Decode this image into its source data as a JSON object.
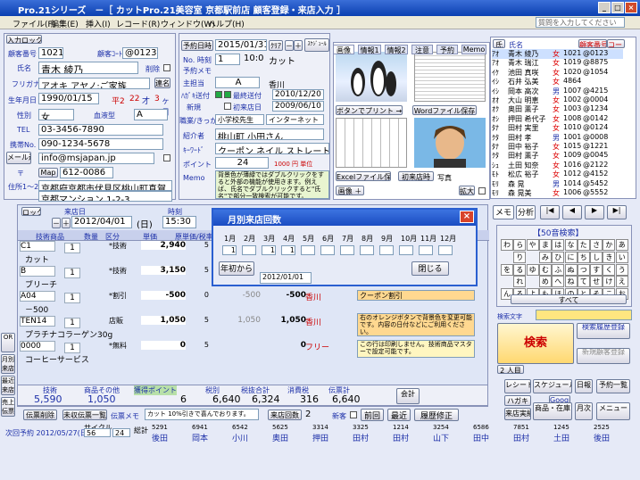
{
  "app": {
    "title": "Pro.21シリーズ　－［ カットPro.21美容室  京都駅前店  顧客登録・来店入力 ］",
    "help_placeholder": "質問を入力してください"
  },
  "menu": [
    "ファイル(F)",
    "編集(E)",
    "挿入(I)",
    "レコード(R)",
    "ウィンドウ(W)",
    "ヘルプ(H)"
  ],
  "customer": {
    "new_label": "入力ロック",
    "number_label": "顧客番号",
    "number": "1021",
    "code_label": "顧客ｺｰﾄﾞ",
    "code": "@0123",
    "delete_label": "削除",
    "name_label": "氏名",
    "name": "青木  綾乃",
    "furigana_label": "フリガナ",
    "furigana": "アオキ アヤノ:ご家族",
    "renraku": "連名",
    "birth_label": "生年月日",
    "birth": "1990/01/15",
    "era": "平2",
    "age": "22",
    "age_unit": "才",
    "month": "3",
    "month_unit": "ヶ月",
    "sex_label": "性別",
    "sex": "女",
    "blood_label": "血液型",
    "blood": "A",
    "tel_label": "TEL",
    "tel": "03-3456-7890",
    "mobile_label": "携帯No.",
    "mobile": "090-1234-5678",
    "mail_btn": "メール送信",
    "mail": "info@msjapan.jp",
    "postal_label": "〒",
    "map_btn": "Map",
    "postal": "612-0086",
    "addr_label": "住所1～2",
    "addr1": "京都府京都市伏見区桃山町真賀",
    "addr2": "京都マンション  1-2-3"
  },
  "reservation": {
    "yoyaku_btn": "予約日時",
    "date": "2015/01/31",
    "clear": "ｸﾘｱ",
    "minus": "－",
    "plus": "＋",
    "schedule": "ｽｹｼﾞｭｰﾙ",
    "no_label": "No.  時刻",
    "no": "1",
    "time": "10:00",
    "menu": "カット",
    "yoyaku_menu": "予約メモ",
    "staff_label": "主担当",
    "staff": "A",
    "staff_name": "香川",
    "dm_label": "ﾊｶﾞｷ送付",
    "dm_check": "最終送付",
    "dm_date": "2010/12/20",
    "new_label": "新規",
    "first_label": "初来店日",
    "first_date": "2009/06/10",
    "job_label": "職業/きっかけ",
    "job": "小学校先生",
    "trigger": "インターネット",
    "intro_label": "紹介者",
    "intro": "桃山町  小田さん",
    "keyword_label": "ｷｰﾜｰﾄﾞ",
    "keyword": "クーポン  ネイル  ストレート",
    "point_label": "ポイント",
    "point": "24",
    "point_unit": "1000 円 単位",
    "memo_label": "Memo",
    "memo": "背景色が薄緑ではダブルクリックをすると外部の機能が使用きます。例えば、氏名でダブルクリックすると\"氏名\"で部分一致検索が可能です。"
  },
  "image_tabs": [
    "画像",
    "情報1",
    "情報2",
    "注意",
    "予約",
    "Memo"
  ],
  "image_buttons": {
    "print": "ボタンでプリント →",
    "word": "Wordファイル保存",
    "excel": "Excelファイル保存",
    "visit": "初来店時",
    "photo": "写真",
    "image": "画像 ＋",
    "expand": "拡大"
  },
  "customer_list": {
    "header_name": "氏名",
    "header_code": "顧客番号",
    "header_code2": "コード",
    "rows": [
      {
        "kana": "ｱｵ",
        "name": "青木  綾乃",
        "sex": "女",
        "no": "1021",
        "code": "@0123"
      },
      {
        "kana": "ｱｵ",
        "name": "青木  瑞江",
        "sex": "女",
        "no": "1019",
        "code": "@8875"
      },
      {
        "kana": "ｲｹ",
        "name": "池田  真咲",
        "sex": "女",
        "no": "1020",
        "code": "@1054"
      },
      {
        "kana": "ｲｼ",
        "name": "石井  弘美",
        "sex": "女",
        "no": "4864",
        "code": ""
      },
      {
        "kana": "ｲｼ",
        "name": "岡本  高次",
        "sex": "男",
        "no": "1007",
        "code": "@4215"
      },
      {
        "kana": "ｵｵ",
        "name": "大山  明恵",
        "sex": "女",
        "no": "1002",
        "code": "@0004"
      },
      {
        "kana": "ｵｸ",
        "name": "奥田  薫子",
        "sex": "女",
        "no": "1003",
        "code": "@1234"
      },
      {
        "kana": "ｵｼ",
        "name": "押田  希代子",
        "sex": "女",
        "no": "1008",
        "code": "@0142"
      },
      {
        "kana": "ﾀﾅ",
        "name": "田村  実里",
        "sex": "女",
        "no": "1010",
        "code": "@0124"
      },
      {
        "kana": "ｸﾀ",
        "name": "田村  孝",
        "sex": "男",
        "no": "1001",
        "code": "@0008"
      },
      {
        "kana": "ﾀﾅ",
        "name": "田中  裕子",
        "sex": "女",
        "no": "1015",
        "code": "@1221"
      },
      {
        "kana": "ｸﾀ",
        "name": "田村  薫子",
        "sex": "女",
        "no": "1009",
        "code": "@0045"
      },
      {
        "kana": "ｼｭ",
        "name": "土田  知奈",
        "sex": "女",
        "no": "1016",
        "code": "@2122"
      },
      {
        "kana": "ﾓﾄ",
        "name": "松広  裕子",
        "sex": "女",
        "no": "1012",
        "code": "@4152"
      },
      {
        "kana": "ﾓﾘ",
        "name": "森  晃",
        "sex": "男",
        "no": "1014",
        "code": "@5452"
      },
      {
        "kana": "ﾓﾘ",
        "name": "森  晃美",
        "sex": "女",
        "no": "1006",
        "code": "@5552"
      }
    ]
  },
  "nav": {
    "memo": "メモ",
    "analysis": "分析",
    "kana_title": "【50音検索】",
    "kana": [
      "わ",
      "ら",
      "や",
      "ま",
      "は",
      "な",
      "た",
      "さ",
      "か",
      "あ",
      "",
      "り",
      "",
      "み",
      "ひ",
      "に",
      "ち",
      "し",
      "き",
      "い",
      "を",
      "る",
      "ゆ",
      "む",
      "ふ",
      "ぬ",
      "つ",
      "す",
      "く",
      "う",
      "",
      "れ",
      "",
      "め",
      "へ",
      "ね",
      "て",
      "せ",
      "け",
      "え",
      "ん",
      "ろ",
      "よ",
      "も",
      "ほ",
      "の",
      "と",
      "そ",
      "こ",
      "お"
    ],
    "all": "すべて",
    "search_label": "検索文字",
    "search_btn": "検索",
    "history": "検索履歴登録",
    "persons": "2 人目",
    "new_reg": "新規顧客登録",
    "receipt": "レシート",
    "schedule": "スケジュール",
    "hagaki": "ハガキ",
    "reserve_list": "予約一覧",
    "calendar": "日報",
    "visit_result": "来店実績",
    "product": "商品・在庫",
    "monthly": "月次",
    "menu": "メニュー",
    "google": "Google",
    "zenkai": "前回"
  },
  "visit": {
    "lock": "ロック",
    "visit_label": "来店日",
    "date": "2012/04/01",
    "dow": "(日)",
    "time_label": "時刻",
    "time": "15:30",
    "minus": "－",
    "plus": "＋"
  },
  "sales_header": [
    "技術商品",
    "数量",
    "区分",
    "単価",
    "原単価/税率",
    "原価",
    "税込合計",
    "担当",
    "残"
  ],
  "sales_rows": [
    {
      "code": "C1",
      "name": "カット",
      "qty": "1",
      "kind": "*技術",
      "price": "2,940",
      "tax": "5",
      "staff": ""
    },
    {
      "code": "B",
      "name": "ブリーチ",
      "qty": "1",
      "kind": "*技術",
      "price": "3,150",
      "tax": "5",
      "staff": ""
    },
    {
      "code": "A04",
      "name": "－500",
      "qty": "1",
      "kind": "*割引",
      "price": "-500",
      "cost": "-500",
      "tax": "0",
      "total": "-500",
      "staff": "香川"
    },
    {
      "code": "TEN14",
      "name": "プラチナコラーゲン30g",
      "qty": "1",
      "kind": "店販",
      "price": "1,050",
      "cost": "1,050",
      "tax": "5",
      "total": "1,050",
      "staff": "香川"
    },
    {
      "code": "0000",
      "name": "コーヒーサービス",
      "qty": "1",
      "kind": "*無料",
      "price": "0",
      "tax": "5",
      "total": "0",
      "staff": "フリー"
    }
  ],
  "sales_notes": {
    "coupon": "クーポン割引",
    "note1": "右のオレンジボタンで背景色を変更可能です。内容の日付などにご利用ください。",
    "note2": "この行は印刷しません。技術商品マスターで設定可能です。"
  },
  "summary": {
    "tech_label": "技術",
    "goods_label": "商品その他",
    "point_label": "獲得ポイント",
    "total_label": "税別",
    "tax_label": "税抜合計",
    "shohi_label": "消費税",
    "dempyo_label": "伝票計",
    "tech": "5,590",
    "goods": "1,050",
    "point": "6",
    "total": "6,640",
    "zeinuki": "6,324",
    "tax": "316",
    "dempyo": "6,640",
    "kaikei": "会計"
  },
  "footer": {
    "delete": "伝票削除",
    "unsent": "未収伝票一覧",
    "memo_label": "伝票メモ",
    "memo": "カット 10%引きで喜んでおります。",
    "visit_times": "来店回数",
    "visit_count": "2",
    "newc": "新客",
    "prev": "前回",
    "latest": "最近",
    "history_edit": "履歴修正",
    "plan": "次回予約 2012/05/27(日)",
    "cycle": "サイクル",
    "cycle_val": "56",
    "stamp": "24",
    "stamp_label": "総計"
  },
  "bottom_strip": [
    {
      "no": "5291",
      "name": "後田"
    },
    {
      "no": "6941",
      "name": "岡本"
    },
    {
      "no": "6542",
      "name": "小川"
    },
    {
      "no": "5625",
      "name": "奥田"
    },
    {
      "no": "3314",
      "name": "押田"
    },
    {
      "no": "3325",
      "name": "田村"
    },
    {
      "no": "1214",
      "name": "田村"
    },
    {
      "no": "3254",
      "name": "山下"
    },
    {
      "no": "6586",
      "name": "田中"
    },
    {
      "no": "7851",
      "name": "田村"
    },
    {
      "no": "1245",
      "name": "土田"
    },
    {
      "no": "2525",
      "name": "後田"
    }
  ],
  "month_dialog": {
    "title": "月別来店回数",
    "months": [
      "1月",
      "2月",
      "3月",
      "4月",
      "5月",
      "6月",
      "7月",
      "8月",
      "9月",
      "10月",
      "11月",
      "12月"
    ],
    "counts": [
      "1",
      "",
      "1",
      "1",
      "",
      "",
      "",
      "",
      "",
      "",
      "",
      ""
    ],
    "btn_start": "年初から",
    "date": "2012/01/01",
    "close": "閉じる"
  }
}
